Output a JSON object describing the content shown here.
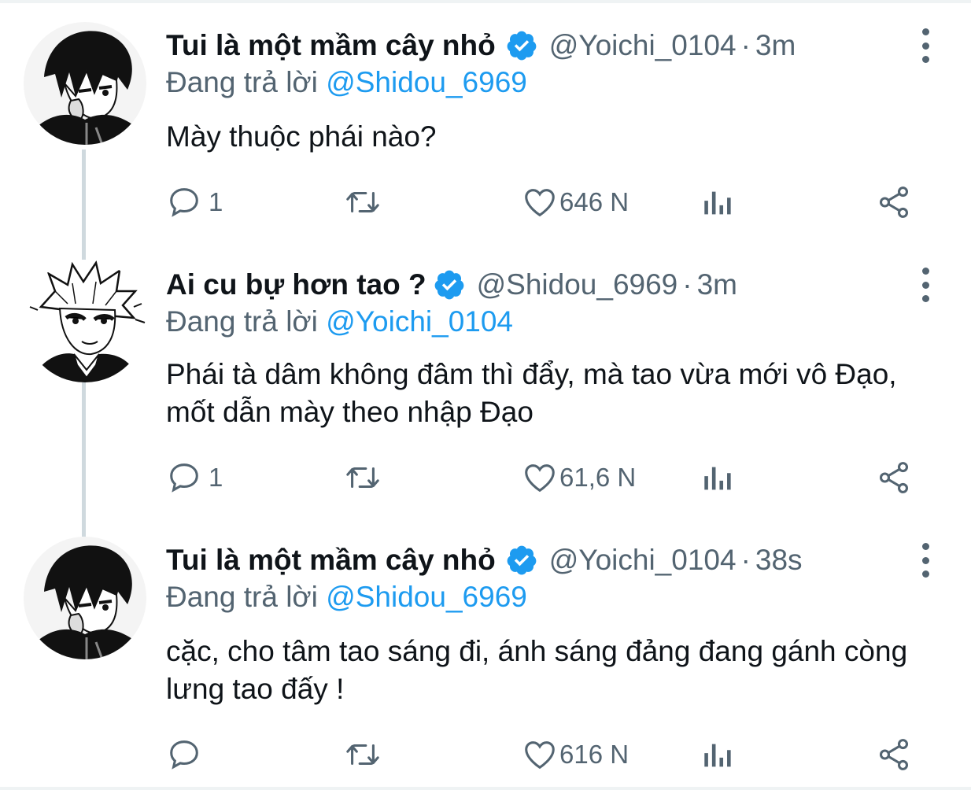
{
  "tweets": [
    {
      "display_name": "Tui là một mầm cây nhỏ",
      "handle": "@Yoichi_0104",
      "separator": "·",
      "time": "3m",
      "replying_prefix": "Đang trả lời ",
      "replying_to": "@Shidou_6969",
      "text": "Mày thuộc phái nào?",
      "reply_count": "1",
      "like_count": "646 N",
      "avatar_icon": "manga-dark-haired-boy-avatar"
    },
    {
      "display_name": "Ai cu bự hơn tao ?",
      "handle": "@Shidou_6969",
      "separator": "·",
      "time": "3m",
      "replying_prefix": "Đang trả lời ",
      "replying_to": "@Yoichi_0104",
      "text": "Phái tà dâm không đâm thì đẩy, mà tao vừa mới vô Đạo, mốt dẫn mày theo nhập Đạo",
      "reply_count": "1",
      "like_count": "61,6 N",
      "avatar_icon": "manga-spiky-haired-boy-avatar"
    },
    {
      "display_name": "Tui là một mầm cây nhỏ",
      "handle": "@Yoichi_0104",
      "separator": "·",
      "time": "38s",
      "replying_prefix": "Đang trả lời ",
      "replying_to": "@Shidou_6969",
      "text": "cặc, cho tâm tao sáng đi, ánh sáng đảng đang gánh còng lưng tao đấy !",
      "reply_count": "",
      "like_count": "616 N",
      "avatar_icon": "manga-dark-haired-boy-avatar"
    }
  ],
  "colors": {
    "text_primary": "#0f1419",
    "text_secondary": "#536471",
    "accent": "#1d9bf0",
    "thread_line": "#cfd9de"
  }
}
